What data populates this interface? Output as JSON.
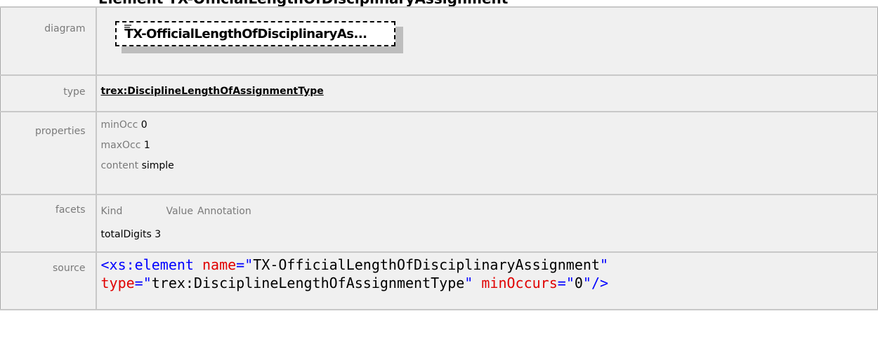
{
  "heading": "Element TX-OfficialLengthOfDisciplinaryAssignment",
  "labels": {
    "diagram": "diagram",
    "type": "type",
    "properties": "properties",
    "facets": "facets",
    "source": "source"
  },
  "diagram": {
    "element_name": "TX-OfficialLengthOfDisciplinaryAs...",
    "icon": "element-annotation-icon"
  },
  "type": {
    "link_text": "trex:DisciplineLengthOfAssignmentType"
  },
  "properties": [
    {
      "key": "minOcc",
      "value": "0"
    },
    {
      "key": "maxOcc",
      "value": "1"
    },
    {
      "key": "content",
      "value": "simple"
    }
  ],
  "facets": {
    "headers": {
      "kind": "Kind",
      "value": "Value",
      "annotation": "Annotation"
    },
    "rows": [
      {
        "kind": "totalDigits",
        "value": "3",
        "annotation": ""
      }
    ]
  },
  "source": {
    "tag": "<xs:element",
    "attrs": [
      {
        "name": "name",
        "value": "TX-OfficialLengthOfDisciplinaryAssignment"
      },
      {
        "name": "type",
        "value": "trex:DisciplineLengthOfAssignmentType"
      },
      {
        "name": "minOccurs",
        "value": "0"
      }
    ],
    "close": "/>"
  },
  "colors": {
    "row_background": "#f0f0f0",
    "border": "#c8c8c8",
    "label_text": "#7a7a7a",
    "xml_tag": "#0000ff",
    "xml_attribute": "#e00000"
  }
}
